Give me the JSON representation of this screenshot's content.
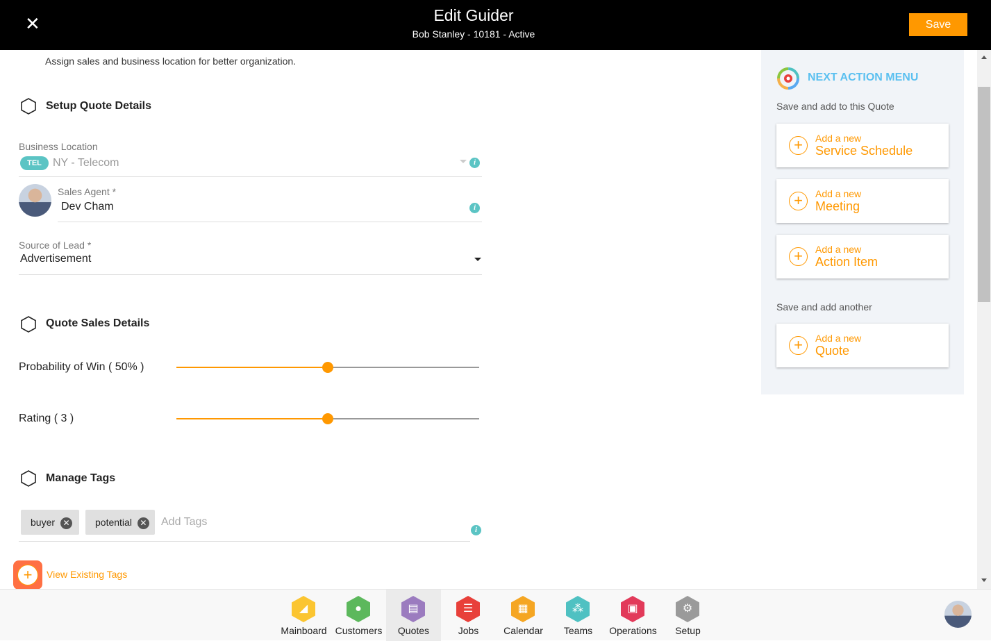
{
  "header": {
    "title": "Edit Guider",
    "subtitle": "Bob Stanley - 10181 - Active",
    "save_label": "Save",
    "close_icon": "close-icon"
  },
  "intro": "Assign sales and business location for better organization.",
  "setup": {
    "title": "Setup Quote Details",
    "business_location": {
      "label": "Business Location",
      "badge": "TEL",
      "value": "NY - Telecom"
    },
    "sales_agent": {
      "label": "Sales Agent *",
      "value": "Dev Cham"
    },
    "source_of_lead": {
      "label": "Source of Lead *",
      "value": "Advertisement"
    }
  },
  "sales": {
    "title": "Quote Sales Details",
    "probability": {
      "label": "Probability of Win ( 50% )",
      "value_percent": 50
    },
    "rating": {
      "label": "Rating ( 3 )",
      "value": 3,
      "fill_percent": 50
    }
  },
  "tags": {
    "title": "Manage Tags",
    "items": [
      "buyer",
      "potential"
    ],
    "placeholder": "Add Tags",
    "view_existing": "View Existing Tags"
  },
  "next_action": {
    "title": "NEXT ACTION MENU",
    "group1": "Save and add to this Quote",
    "group2": "Save and add another",
    "prefix": "Add a new",
    "cards": [
      "Service Schedule",
      "Meeting",
      "Action Item"
    ],
    "card_another": "Quote"
  },
  "nav": {
    "active": "Quotes",
    "items": [
      {
        "label": "Mainboard",
        "color": "#fbc531"
      },
      {
        "label": "Customers",
        "color": "#5cb85c"
      },
      {
        "label": "Quotes",
        "color": "#9b7bbf"
      },
      {
        "label": "Jobs",
        "color": "#e8403a"
      },
      {
        "label": "Calendar",
        "color": "#f5a623"
      },
      {
        "label": "Teams",
        "color": "#4fc1c2"
      },
      {
        "label": "Operations",
        "color": "#e23a5a"
      },
      {
        "label": "Setup",
        "color": "#9a9a9a"
      }
    ]
  },
  "colors": {
    "accent": "#ff9800",
    "teal": "#5bc4c4",
    "panel_title": "#5bc0f0"
  }
}
